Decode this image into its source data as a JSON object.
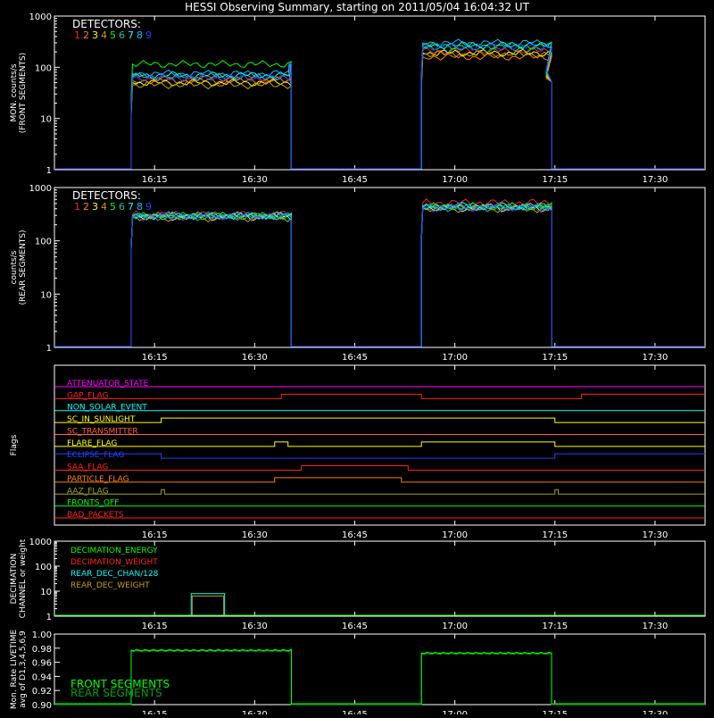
{
  "title": "HESSI Observing Summary, starting on 2011/05/04 16:04:32 UT",
  "colors": {
    "det": [
      "#ff2020",
      "#ff8000",
      "#ffff00",
      "#c8a000",
      "#00ff00",
      "#20c0a0",
      "#00ffff",
      "#00c0ff",
      "#2040ff"
    ],
    "axis": "#ffffff"
  },
  "x_ticks": [
    "16:15",
    "16:30",
    "16:45",
    "17:00",
    "17:15",
    "17:30"
  ],
  "x_range_min": [
    0,
    67.5
  ],
  "chart_data": [
    {
      "id": "front",
      "type": "line",
      "ylabel": [
        "MON. counts/s",
        "(FRONT SEGMENTS)"
      ],
      "yscale": "log",
      "ylim": [
        1,
        1000
      ],
      "y_ticks": [
        "1",
        "10",
        "100",
        "1000"
      ],
      "legend_title": "DETECTORS:",
      "legend_items": [
        "1",
        "2",
        "3",
        "4",
        "5",
        "6",
        "7",
        "8",
        "9"
      ],
      "segments": [
        {
          "start": 11.5,
          "end": 35.5,
          "levels": [
            60,
            55,
            50,
            45,
            115,
            65,
            70,
            75,
            62
          ],
          "end_jump": 80
        },
        {
          "start": 55.0,
          "end": 74.5,
          "levels": [
            210,
            160,
            190,
            180,
            260,
            230,
            270,
            300,
            250
          ],
          "end_tail": 75
        }
      ]
    },
    {
      "id": "rear",
      "type": "line",
      "ylabel": [
        "counts/s",
        "(REAR SEGMENTS)"
      ],
      "yscale": "log",
      "ylim": [
        1,
        1000
      ],
      "y_ticks": [
        "1",
        "10",
        "100",
        "1000"
      ],
      "legend_title": "DETECTORS:",
      "legend_items": [
        "1",
        "2",
        "3",
        "4",
        "5",
        "6",
        "7",
        "8",
        "9"
      ],
      "segments": [
        {
          "start": 11.5,
          "end": 35.5,
          "levels": [
            310,
            300,
            280,
            270,
            290,
            285,
            295,
            300,
            280
          ]
        },
        {
          "start": 55.0,
          "end": 74.5,
          "levels": [
            520,
            430,
            410,
            400,
            440,
            420,
            450,
            430,
            410
          ]
        }
      ]
    },
    {
      "id": "flags",
      "type": "step",
      "ylabel": [
        "Flags"
      ],
      "flags": [
        {
          "name": "ATTENUATOR_STATE",
          "color": "#ff00ff",
          "steps": [
            [
              0,
              0
            ],
            [
              90,
              0
            ]
          ]
        },
        {
          "name": "GAP_FLAG",
          "color": "#ff2020",
          "steps": [
            [
              0,
              0
            ],
            [
              34,
              1
            ],
            [
              55,
              0
            ],
            [
              79,
              1
            ],
            [
              90,
              1
            ]
          ]
        },
        {
          "name": "NON_SOLAR_EVENT",
          "color": "#00ffff",
          "steps": [
            [
              0,
              0
            ],
            [
              90,
              0
            ]
          ]
        },
        {
          "name": "SC_IN_SUNLIGHT",
          "color": "#ffff00",
          "steps": [
            [
              0,
              0
            ],
            [
              16,
              1
            ],
            [
              75,
              0
            ],
            [
              90,
              0
            ]
          ]
        },
        {
          "name": "SC_TRANSMITTER",
          "color": "#ff6040",
          "steps": [
            [
              0,
              0
            ],
            [
              90,
              0
            ]
          ]
        },
        {
          "name": "FLARE_FLAG",
          "color": "#ffff00",
          "steps": [
            [
              0,
              0
            ],
            [
              33,
              1
            ],
            [
              35,
              0
            ],
            [
              55,
              1
            ],
            [
              75,
              0
            ],
            [
              90,
              0
            ]
          ]
        },
        {
          "name": "ECLIPSE_FLAG",
          "color": "#2040ff",
          "steps": [
            [
              0,
              1
            ],
            [
              16,
              0
            ],
            [
              75,
              1
            ],
            [
              90,
              1
            ]
          ]
        },
        {
          "name": "SAA_FLAG",
          "color": "#ff2020",
          "steps": [
            [
              0,
              0
            ],
            [
              37,
              1
            ],
            [
              53,
              0
            ],
            [
              90,
              0
            ]
          ]
        },
        {
          "name": "PARTICLE_FLAG",
          "color": "#ff8000",
          "steps": [
            [
              0,
              0
            ],
            [
              33,
              1
            ],
            [
              52,
              0
            ],
            [
              90,
              0
            ]
          ]
        },
        {
          "name": "AAZ_FLAG",
          "color": "#a0a020",
          "steps": [
            [
              0,
              0
            ],
            [
              16,
              1
            ],
            [
              16.5,
              0
            ],
            [
              75,
              1
            ],
            [
              75.5,
              0
            ],
            [
              90,
              0
            ]
          ]
        },
        {
          "name": "FRONTS_OFF",
          "color": "#00ff00",
          "steps": [
            [
              0,
              0
            ],
            [
              90,
              0
            ]
          ]
        },
        {
          "name": "BAD_PACKETS",
          "color": "#ff2020",
          "steps": [
            [
              0,
              0
            ],
            [
              90,
              0
            ]
          ]
        }
      ]
    },
    {
      "id": "decimation",
      "type": "step",
      "ylabel": [
        "DECIMATION",
        "CHANNEL or weight"
      ],
      "yscale": "log",
      "ylim": [
        1,
        1000
      ],
      "y_ticks": [
        "1",
        "10",
        "100",
        "1000"
      ],
      "legend_items": [
        {
          "name": "DECIMATION_ENERGY",
          "color": "#00ff00"
        },
        {
          "name": "DECIMATION_WEIGHT",
          "color": "#ff2020"
        },
        {
          "name": "REAR_DEC_CHAN/128",
          "color": "#00ffff"
        },
        {
          "name": "REAR_DEC_WEIGHT",
          "color": "#c8a000"
        }
      ],
      "box": {
        "start": 20.5,
        "end": 25.5,
        "value": 8
      }
    },
    {
      "id": "livetime",
      "type": "line",
      "ylabel": [
        "Mon. Rate LIVETIME",
        "avg of D1,3,4,5,6,9"
      ],
      "ylim": [
        0.9,
        1.0
      ],
      "y_ticks": [
        "0.90",
        "0.92",
        "0.94",
        "0.96",
        "0.98",
        "1.00"
      ],
      "legend_items": [
        {
          "name": "FRONT SEGMENTS",
          "color": "#00ff00"
        },
        {
          "name": "REAR SEGMENTS",
          "color": "#00a000"
        }
      ],
      "segments": [
        {
          "start": 11.5,
          "end": 35.5,
          "value": 0.976
        },
        {
          "start": 55.0,
          "end": 74.5,
          "value": 0.972
        }
      ]
    }
  ]
}
